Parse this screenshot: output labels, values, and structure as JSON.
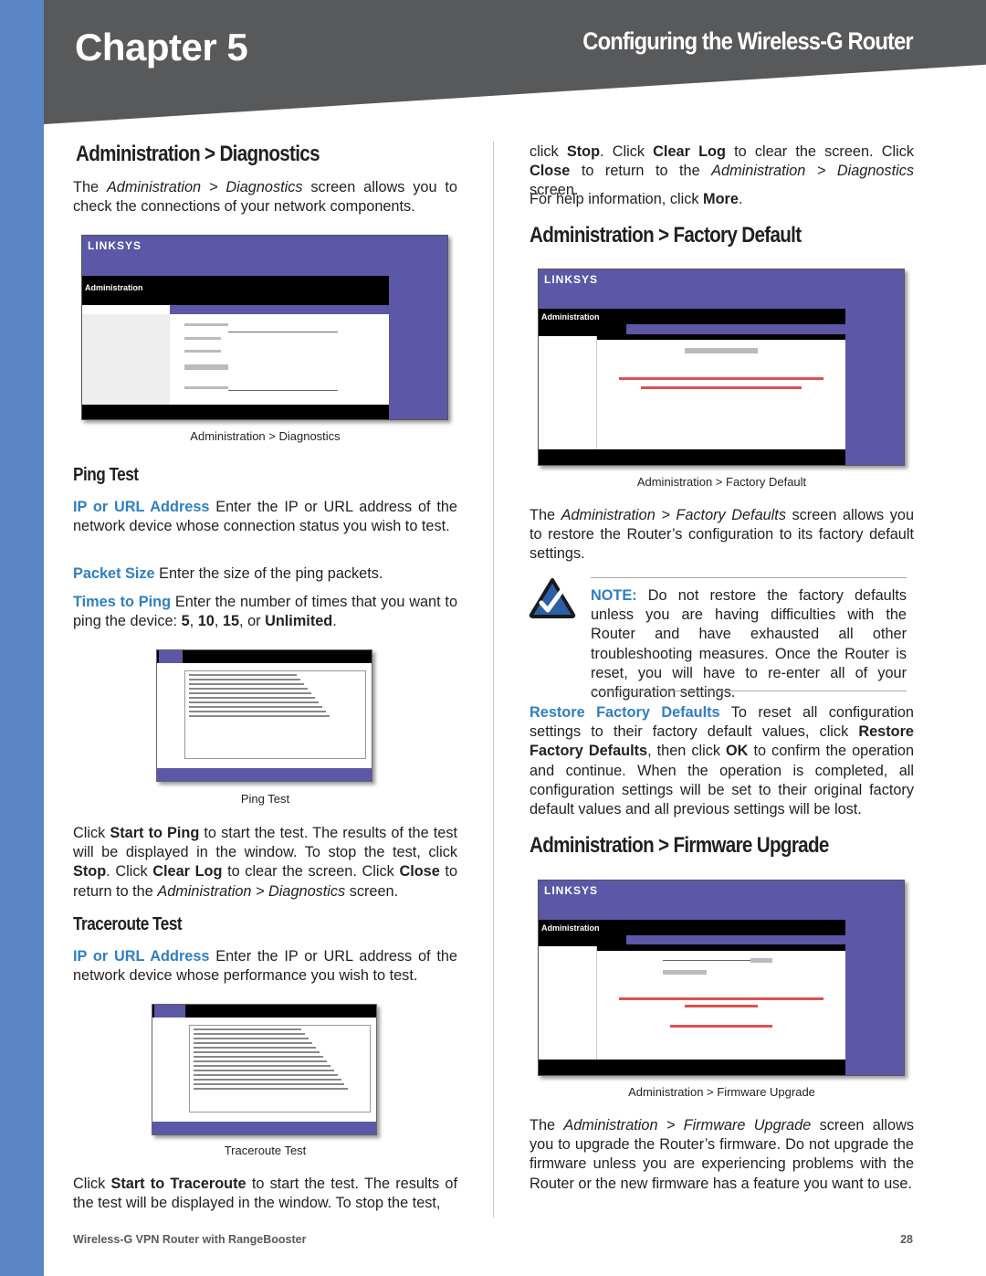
{
  "header": {
    "chapter": "Chapter 5",
    "title": "Configuring the Wireless-G Router"
  },
  "left": {
    "h_diag": "Administration > Diagnostics",
    "p_intro": [
      [
        "",
        "The "
      ],
      [
        "i",
        "Administration > Diagnostics"
      ],
      [
        "",
        " screen allows you to check the connections of your network components."
      ]
    ],
    "cap_diag": "Administration > Diagnostics",
    "h_ping": "Ping Test",
    "p_ip": [
      [
        "k",
        "IP or URL Address"
      ],
      [
        "",
        " Enter the IP or URL address of the network device whose connection status you wish to test."
      ]
    ],
    "p_size": [
      [
        "k",
        "Packet Size"
      ],
      [
        "",
        " Enter the size of the ping packets."
      ]
    ],
    "p_times": [
      [
        "k",
        "Times to Ping"
      ],
      [
        "",
        " Enter the number of times that you want to ping the device: "
      ],
      [
        "b",
        "5"
      ],
      [
        "",
        ", "
      ],
      [
        "b",
        "10"
      ],
      [
        "",
        ", "
      ],
      [
        "b",
        "15"
      ],
      [
        "",
        ", or "
      ],
      [
        "b",
        "Unlimited"
      ],
      [
        "",
        "."
      ]
    ],
    "cap_ping": "Ping Test",
    "p_start": [
      [
        "",
        "Click "
      ],
      [
        "b",
        "Start to Ping"
      ],
      [
        "",
        " to start the test. The results of the test will be displayed in the window. To stop the test, click "
      ],
      [
        "b",
        "Stop"
      ],
      [
        "",
        ". Click "
      ],
      [
        "b",
        "Clear Log"
      ],
      [
        "",
        " to clear the screen. Click "
      ],
      [
        "b",
        "Close"
      ],
      [
        "",
        " to return to the "
      ],
      [
        "i",
        "Administration > Diagnostics"
      ],
      [
        "",
        " screen."
      ]
    ],
    "h_trace": "Traceroute Test",
    "p_ip2": [
      [
        "k",
        "IP or URL Address"
      ],
      [
        "",
        " Enter the IP or URL address of the network device whose performance you wish to test."
      ]
    ],
    "cap_trace": "Traceroute Test",
    "p_trace": [
      [
        "",
        "Click "
      ],
      [
        "b",
        "Start to Traceroute"
      ],
      [
        "",
        " to start the test. The results of the test will be displayed in the window. To stop the test,"
      ]
    ]
  },
  "right": {
    "p_cont": [
      [
        "",
        "click "
      ],
      [
        "b",
        "Stop"
      ],
      [
        "",
        ". Click "
      ],
      [
        "b",
        "Clear Log"
      ],
      [
        "",
        " to clear the screen. Click "
      ],
      [
        "b",
        "Close"
      ],
      [
        "",
        " to return to the "
      ],
      [
        "i",
        "Administration > Diagnostics"
      ],
      [
        "",
        " screen."
      ]
    ],
    "p_help": [
      [
        "",
        "For help information, click "
      ],
      [
        "b",
        "More"
      ],
      [
        "",
        "."
      ]
    ],
    "h_factory": "Administration > Factory Default",
    "cap_factory": "Administration > Factory Default",
    "p_factory": [
      [
        "",
        "The "
      ],
      [
        "i",
        "Administration > Factory Defaults"
      ],
      [
        "",
        " screen allows you to restore the Router’s configuration to its factory default settings."
      ]
    ],
    "note": [
      [
        "k",
        "NOTE:"
      ],
      [
        "",
        " Do not restore the factory defaults unless you are having difficulties with the Router and have exhausted all other troubleshooting measures. Once the Router is reset, you will have to re-enter all of your configuration settings."
      ]
    ],
    "p_restore": [
      [
        "k",
        "Restore Factory Defaults"
      ],
      [
        "",
        " To reset all configuration settings to their factory default values, click "
      ],
      [
        "b",
        "Restore Factory Defaults"
      ],
      [
        "",
        ", then click "
      ],
      [
        "b",
        "OK"
      ],
      [
        "",
        " to confirm the operation and continue. When the operation is completed, all configuration settings will be set to their original factory default values and all previous settings will be lost."
      ]
    ],
    "h_firmware": "Administration > Firmware Upgrade",
    "cap_firmware": "Administration > Firmware Upgrade",
    "p_firmware": [
      [
        "",
        "The "
      ],
      [
        "i",
        "Administration > Firmware Upgrade"
      ],
      [
        "",
        " screen allows you to upgrade the Router’s firmware. Do not upgrade the firmware unless you are experiencing problems with the Router or the new firmware has a feature you want to use."
      ]
    ]
  },
  "shots": {
    "logo": "LINKSYS",
    "section": "Administration"
  },
  "footer": {
    "product": "Wireless-G VPN Router with RangeBooster",
    "page": "28"
  },
  "colors": {
    "accent": "#2f7fc1",
    "header_bg": "#58595b",
    "side_strip": "#5b86c5",
    "linksys_purple": "#5c57a6"
  }
}
